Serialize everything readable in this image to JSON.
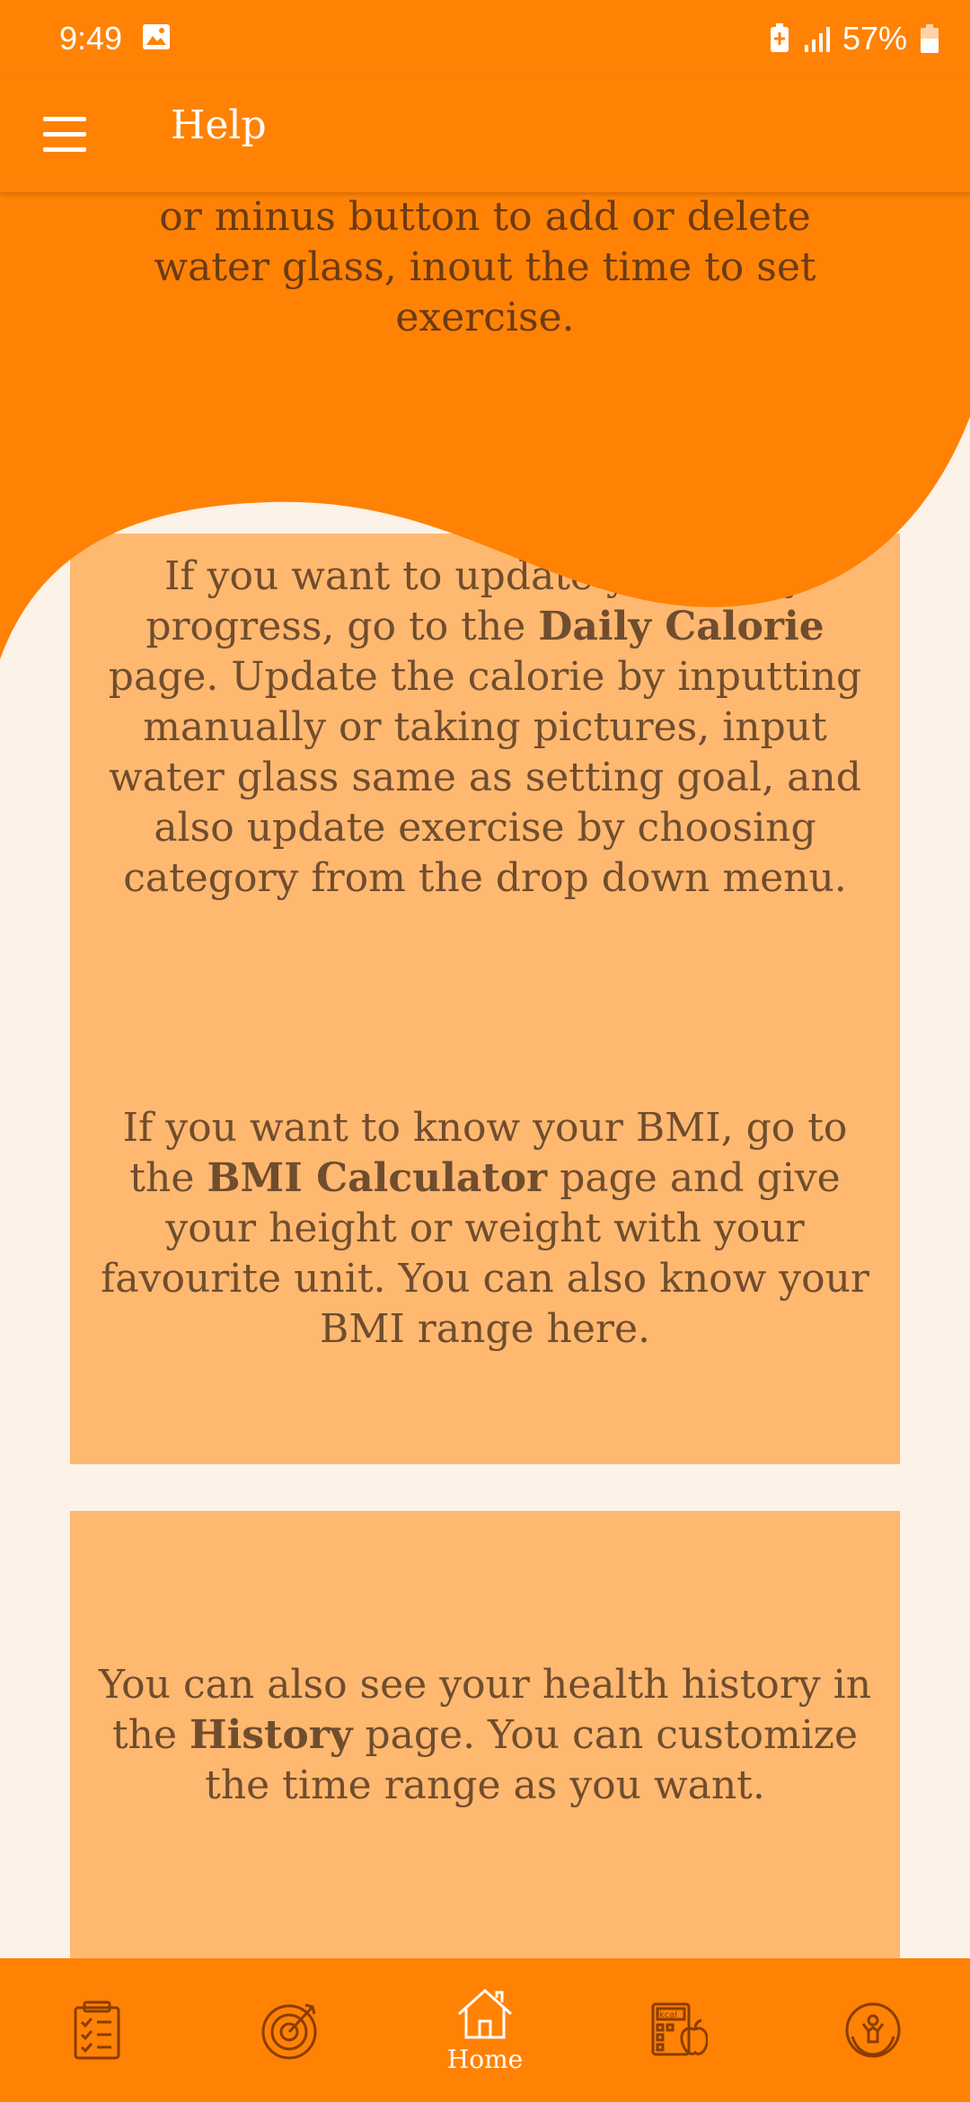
{
  "status_bar": {
    "time": "9:49",
    "battery": "57%"
  },
  "app_bar": {
    "title": "Help"
  },
  "sections": {
    "top_continuation": "or minus button to add or delete water glass, inout the time to set exercise.",
    "daily": {
      "before": "If you want to update your daily progress, go to the ",
      "bold": "Daily Calorie",
      "after": " page. Update the calorie by inputting manually or taking pictures, input water glass same as setting goal, and also update exercise by choosing category from the drop down menu."
    },
    "bmi": {
      "before": "If you want to know your BMI, go to the ",
      "bold": "BMI Calculator",
      "after": " page and give your height or weight with your favourite unit. You can also know your BMI range here."
    },
    "history": {
      "before": "You can also see your health history in the ",
      "bold": "History",
      "after": " page. You can customize the time range as you want."
    }
  },
  "bottom_nav": {
    "items": [
      {
        "icon": "checklist-icon",
        "label": ""
      },
      {
        "icon": "target-icon",
        "label": ""
      },
      {
        "icon": "home-icon",
        "label": "Home"
      },
      {
        "icon": "calorie-calculator-icon",
        "label": ""
      },
      {
        "icon": "fitness-icon",
        "label": ""
      }
    ]
  },
  "colors": {
    "primary": "#ff8205",
    "card": "#ffb870",
    "background": "#fdf2e7",
    "text": "#6f4d2e"
  }
}
